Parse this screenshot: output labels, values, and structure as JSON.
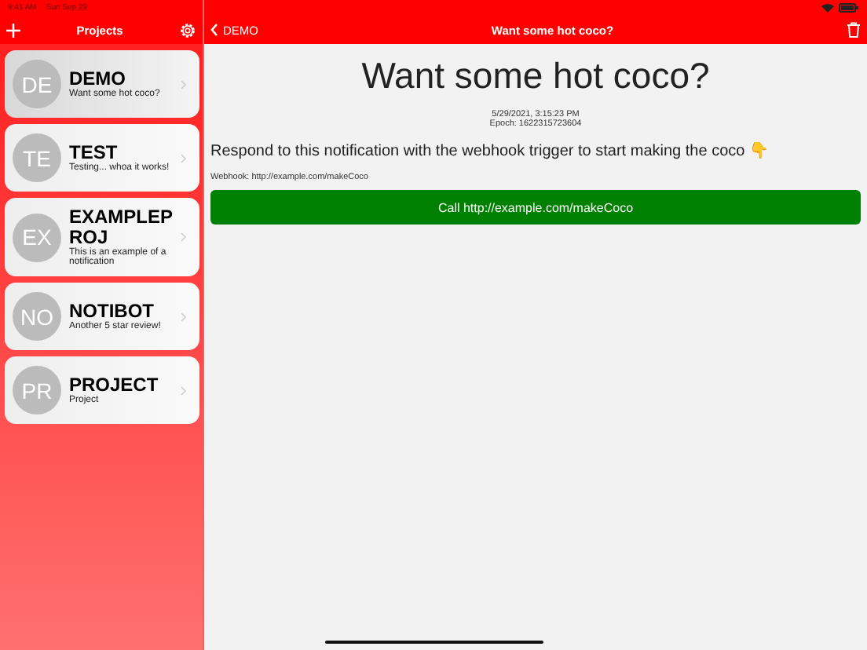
{
  "status_bar": {
    "time": "9:41 AM",
    "date": "Sun Sep 29"
  },
  "sidebar": {
    "title": "Projects",
    "items": [
      {
        "initials": "DE",
        "name": "DEMO",
        "subtitle": "Want some hot coco?",
        "selected": true
      },
      {
        "initials": "TE",
        "name": "TEST",
        "subtitle": "Testing... whoa it works!",
        "selected": false
      },
      {
        "initials": "EX",
        "name": "EXAMPLEPROJ",
        "subtitle": "This is an example of a notification",
        "selected": false
      },
      {
        "initials": "NO",
        "name": "NOTIBOT",
        "subtitle": "Another 5 star review!",
        "selected": false
      },
      {
        "initials": "PR",
        "name": "PROJECT",
        "subtitle": "Project",
        "selected": false
      }
    ]
  },
  "detail": {
    "back_label": "DEMO",
    "nav_title": "Want some hot coco?",
    "heading": "Want some hot coco?",
    "timestamp": "5/29/2021, 3:15:23 PM",
    "epoch": "Epoch: 1622315723604",
    "message": "Respond to this notification with the webhook trigger to start making the coco 👇",
    "webhook": "Webhook: http://example.com/makeCoco",
    "action_button": "Call http://example.com/makeCoco"
  }
}
